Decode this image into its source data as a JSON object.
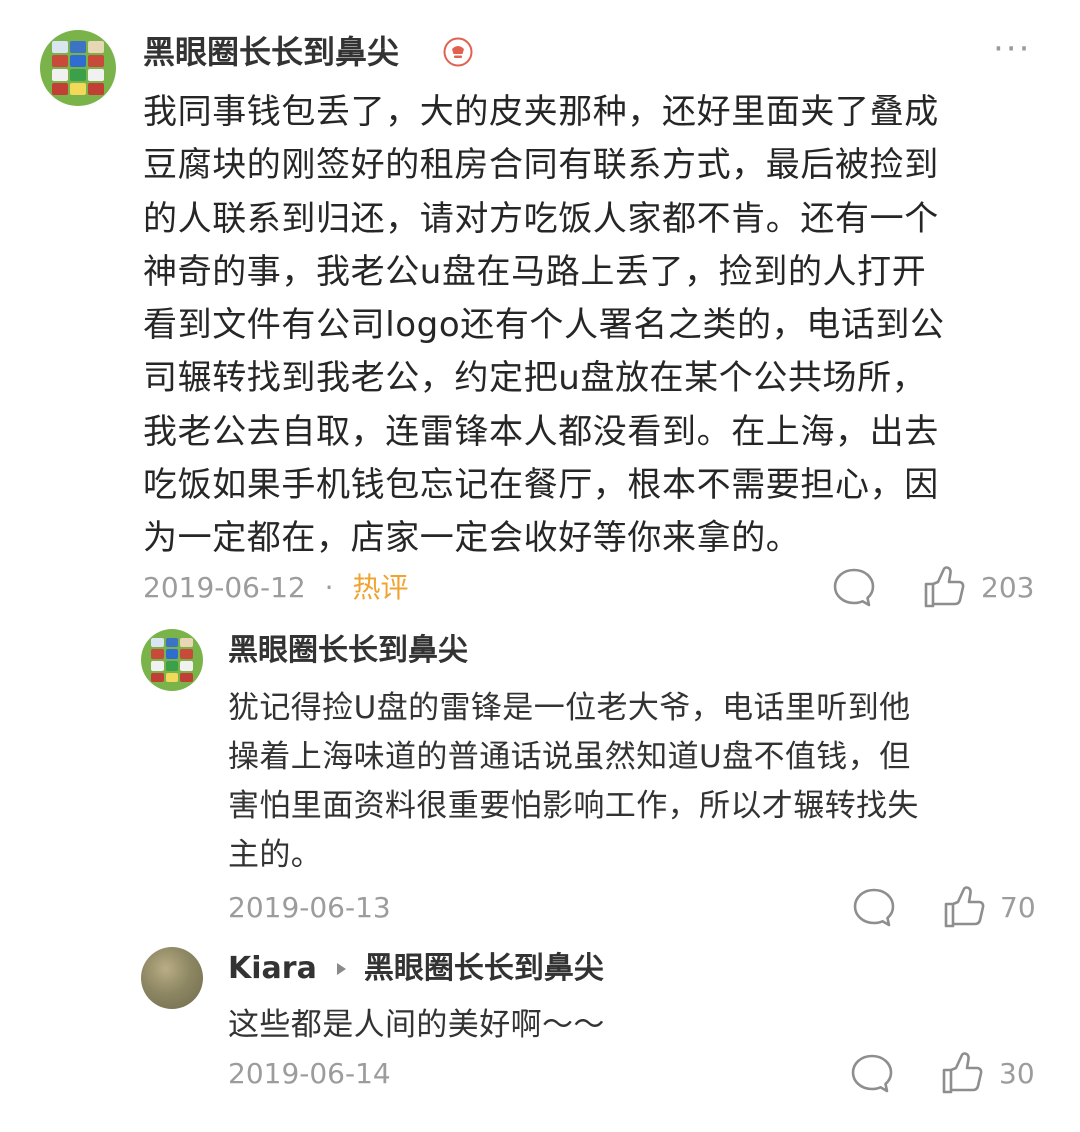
{
  "comments": [
    {
      "author": "黑眼圈长长到鼻尖",
      "lines": [
        "我同事钱包丢了，大的皮夹那种，还好里面夹了叠成",
        "豆腐块的刚签好的租房合同有联系方式，最后被捡到",
        "的人联系到归还，请对方吃饭人家都不肯。还有一个",
        "神奇的事，我老公u盘在马路上丢了，捡到的人打开",
        "看到文件有公司logo还有个人署名之类的，电话到公",
        "司辗转找到我老公，约定把u盘放在某个公共场所，",
        "我老公去自取，连雷锋本人都没看到。在上海，出去",
        "吃饭如果手机钱包忘记在餐厅，根本不需要担心，因",
        "为一定都在，店家一定会收好等你来拿的。"
      ],
      "date": "2019-06-12",
      "separator": "·",
      "tag": "热评",
      "likes": "203",
      "more": "···"
    },
    {
      "author": "黑眼圈长长到鼻尖",
      "lines": [
        "犹记得捡U盘的雷锋是一位老大爷，电话里听到他",
        "操着上海味道的普通话说虽然知道U盘不值钱，但",
        "害怕里面资料很重要怕影响工作，所以才辗转找失",
        "主的。"
      ],
      "date": "2019-06-13",
      "likes": "70"
    },
    {
      "author": "Kiara",
      "reply_to": "黑眼圈长长到鼻尖",
      "lines": [
        "这些都是人间的美好啊～～"
      ],
      "date": "2019-06-14",
      "likes": "30"
    }
  ],
  "icons": {
    "badge": "vip-badge-icon",
    "reply": "comment-bubble-icon",
    "like": "thumbs-up-icon",
    "reply_arrow": "play-arrow-icon"
  },
  "colors": {
    "hot_tag": "#f1a331",
    "meta": "#9c9c9c",
    "text": "#262626",
    "badge": "#e0614f"
  }
}
